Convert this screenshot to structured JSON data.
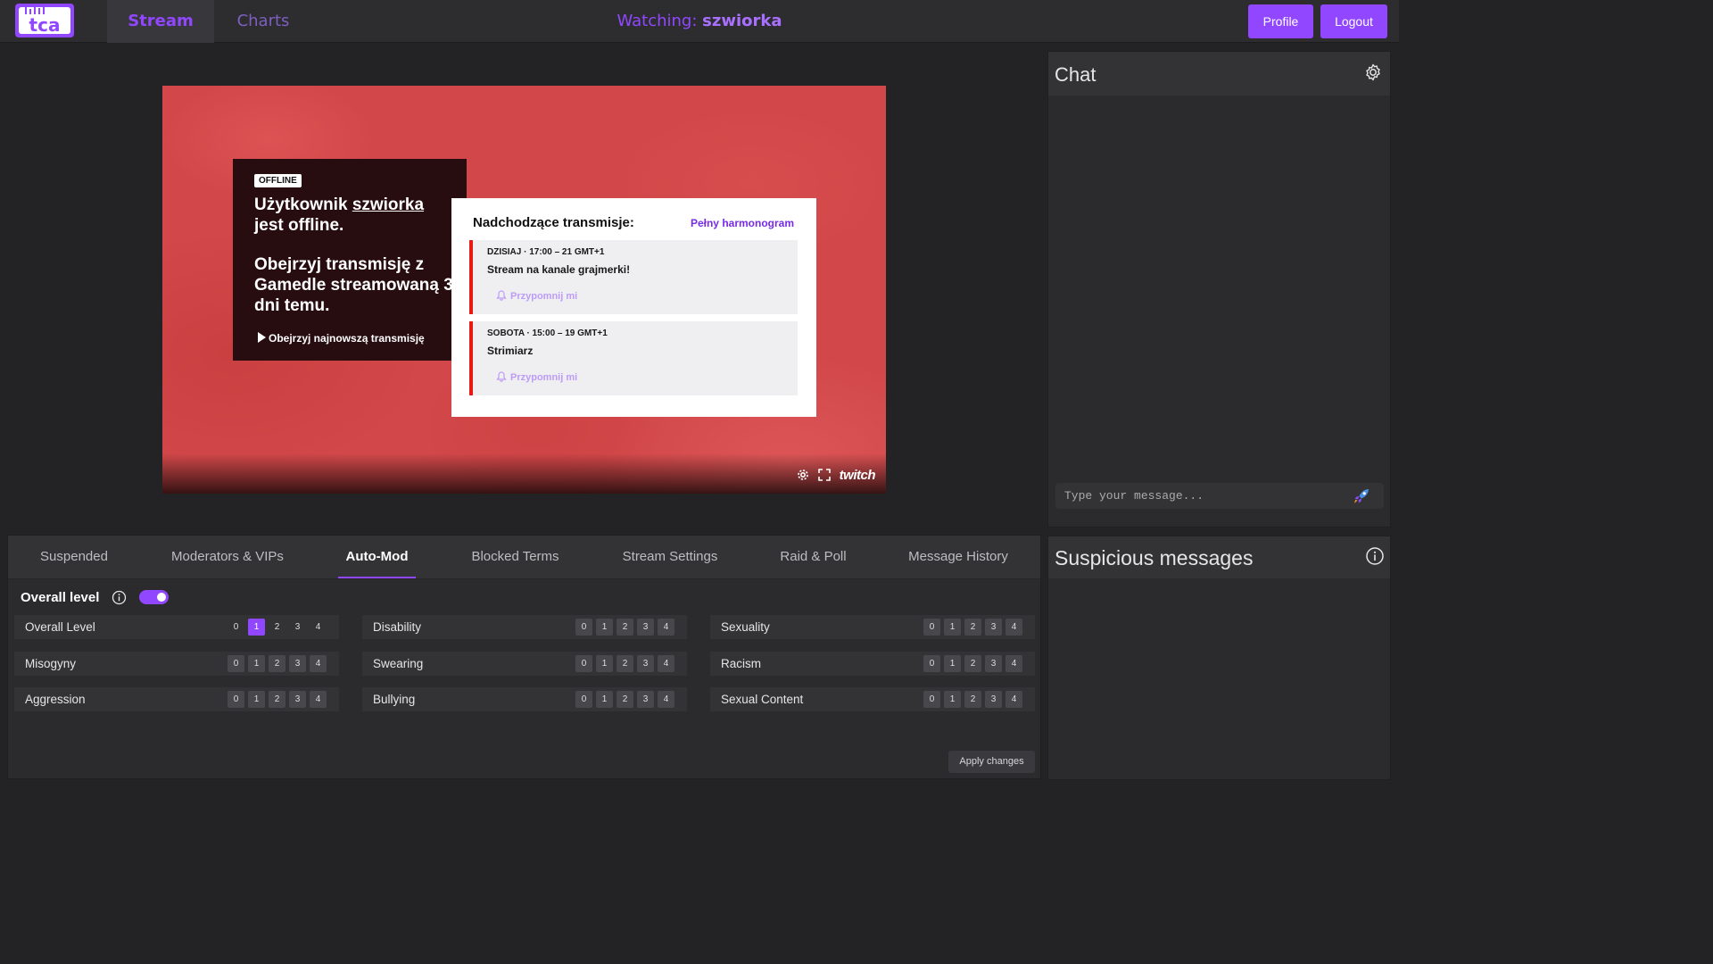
{
  "nav": {
    "logo_icon": "tca-logo-icon",
    "tabs": [
      {
        "label": "Stream",
        "active": true
      },
      {
        "label": "Charts",
        "active": false
      }
    ],
    "watching_prefix": "Watching:",
    "channel": "szwiorka",
    "profile_label": "Profile",
    "logout_label": "Logout",
    "accent_color": "#9147ff"
  },
  "player": {
    "offline_badge": "OFFLINE",
    "offline_title_pre": "Użytkownik ",
    "offline_title_user": "szwiorka",
    "offline_title_post": "jest offline.",
    "offline_subtitle": "Obejrzyj transmisję z Gamedle streamowaną 3 dni temu.",
    "watch_latest_label": "Obejrzyj najnowszą transmisję",
    "schedule": {
      "title": "Nadchodzące transmisje:",
      "full_schedule_label": "Pełny harmonogram",
      "items": [
        {
          "when": "DZISIAJ · 17:00 – 21 GMT+1",
          "title": "Stream na kanale grajmerki!",
          "remind_label": "Przypomnij mi"
        },
        {
          "when": "SOBOTA · 15:00 – 19 GMT+1",
          "title": "Strimiarz",
          "remind_label": "Przypomnij mi"
        }
      ]
    },
    "brand_label": "twitch"
  },
  "chat": {
    "title": "Chat",
    "input_placeholder": "Type your message...",
    "settings_icon": "gear-icon",
    "send_icon": "rocket-icon"
  },
  "suspicious": {
    "title": "Suspicious messages",
    "info_icon": "info-icon"
  },
  "moderation": {
    "tabs": [
      {
        "label": "Suspended",
        "active": false
      },
      {
        "label": "Moderators & VIPs",
        "active": false
      },
      {
        "label": "Auto-Mod",
        "active": true
      },
      {
        "label": "Blocked Terms",
        "active": false
      },
      {
        "label": "Stream Settings",
        "active": false
      },
      {
        "label": "Raid & Poll",
        "active": false
      },
      {
        "label": "Message History",
        "active": false
      }
    ],
    "overall_toggle_label": "Overall level",
    "overall_toggle_on": true,
    "level_options": [
      "0",
      "1",
      "2",
      "3",
      "4"
    ],
    "categories": [
      {
        "label": "Overall Level",
        "selected": 1,
        "enabled": true
      },
      {
        "label": "Disability",
        "selected": null,
        "enabled": false
      },
      {
        "label": "Sexuality",
        "selected": null,
        "enabled": false
      },
      {
        "label": "Misogyny",
        "selected": null,
        "enabled": false
      },
      {
        "label": "Swearing",
        "selected": null,
        "enabled": false
      },
      {
        "label": "Racism",
        "selected": null,
        "enabled": false
      },
      {
        "label": "Aggression",
        "selected": null,
        "enabled": false
      },
      {
        "label": "Bullying",
        "selected": null,
        "enabled": false
      },
      {
        "label": "Sexual Content",
        "selected": null,
        "enabled": false
      }
    ],
    "apply_label": "Apply changes"
  }
}
